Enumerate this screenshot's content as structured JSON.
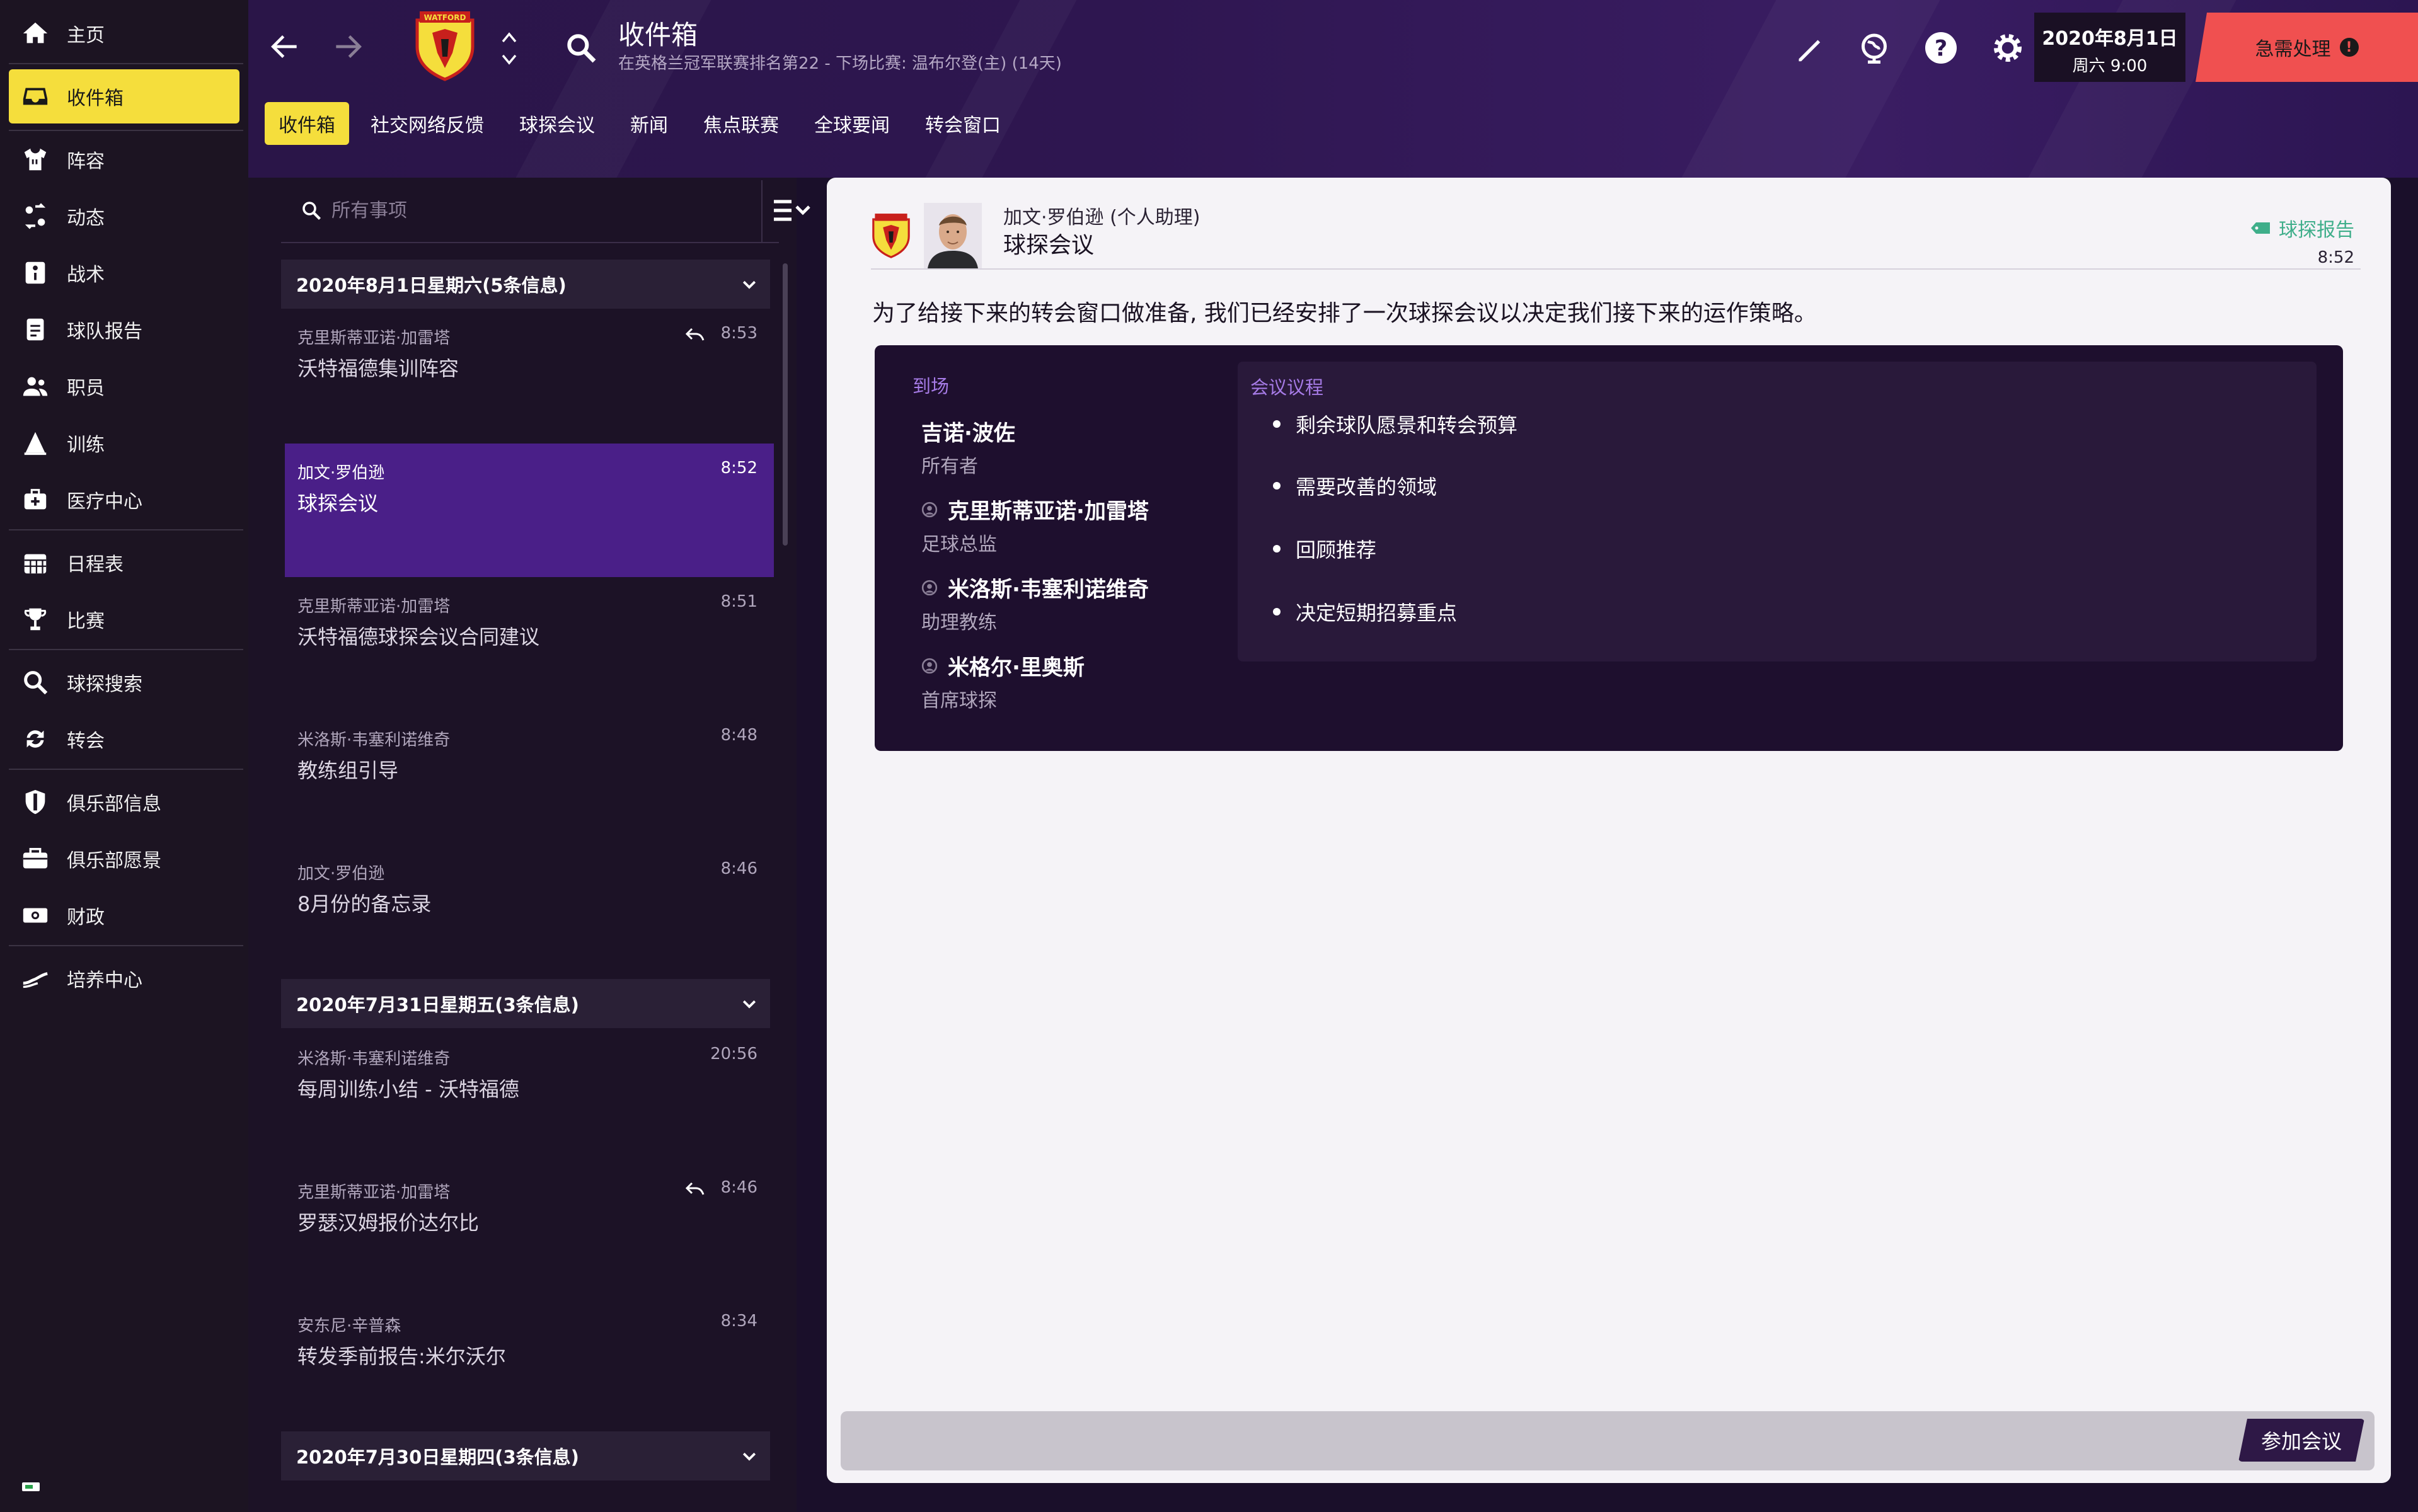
{
  "sidebar": {
    "items": [
      {
        "label": "主页",
        "icon": "home-icon"
      },
      {
        "label": "收件箱",
        "icon": "inbox-icon"
      },
      {
        "label": "阵容",
        "icon": "shirt-icon"
      },
      {
        "label": "动态",
        "icon": "dynamics-icon"
      },
      {
        "label": "战术",
        "icon": "tactics-icon"
      },
      {
        "label": "球队报告",
        "icon": "report-icon"
      },
      {
        "label": "职员",
        "icon": "staff-icon"
      },
      {
        "label": "训练",
        "icon": "training-icon"
      },
      {
        "label": "医疗中心",
        "icon": "medical-icon"
      },
      {
        "label": "日程表",
        "icon": "calendar-icon"
      },
      {
        "label": "比赛",
        "icon": "trophy-icon"
      },
      {
        "label": "球探搜索",
        "icon": "search-icon"
      },
      {
        "label": "转会",
        "icon": "transfer-icon"
      },
      {
        "label": "俱乐部信息",
        "icon": "shield-icon"
      },
      {
        "label": "俱乐部愿景",
        "icon": "briefcase-icon"
      },
      {
        "label": "财政",
        "icon": "money-icon"
      },
      {
        "label": "培养中心",
        "icon": "development-icon"
      }
    ]
  },
  "header": {
    "title": "收件箱",
    "subtitle": "在英格兰冠军联赛排名第22 - 下场比赛: 温布尔登(主) (14天)",
    "club_badge_text": "WATFORD",
    "tabs": [
      "收件箱",
      "社交网络反馈",
      "球探会议",
      "新闻",
      "焦点联赛",
      "全球要闻",
      "转会窗口"
    ],
    "date": "2020年8月1日",
    "day_time": "周六 9:00",
    "urgent_label": "急需处理",
    "urgent_mark": "!"
  },
  "inbox": {
    "search_placeholder": "所有事项",
    "groups": [
      {
        "title": "2020年8月1日星期六(5条信息)",
        "messages": [
          {
            "sender": "克里斯蒂亚诺·加雷塔",
            "subject": "沃特福德集训阵容",
            "time": "8:53"
          },
          {
            "sender": "加文·罗伯逊",
            "subject": "球探会议",
            "time": "8:52"
          },
          {
            "sender": "克里斯蒂亚诺·加雷塔",
            "subject": "沃特福德球探会议合同建议",
            "time": "8:51"
          },
          {
            "sender": "米洛斯·韦塞利诺维奇",
            "subject": "教练组引导",
            "time": "8:48"
          },
          {
            "sender": "加文·罗伯逊",
            "subject": "8月份的备忘录",
            "time": "8:46"
          }
        ]
      },
      {
        "title": "2020年7月31日星期五(3条信息)",
        "messages": [
          {
            "sender": "米洛斯·韦塞利诺维奇",
            "subject": "每周训练小结 - 沃特福德",
            "time": "20:56"
          },
          {
            "sender": "克里斯蒂亚诺·加雷塔",
            "subject": "罗瑟汉姆报价达尔比",
            "time": "8:46"
          },
          {
            "sender": "安东尼·辛普森",
            "subject": "转发季前报告:米尔沃尔",
            "time": "8:34"
          }
        ]
      },
      {
        "title": "2020年7月30日星期四(3条信息)",
        "messages": []
      }
    ]
  },
  "message": {
    "from": "加文·罗伯逊 (个人助理)",
    "subject": "球探会议",
    "tag": "球探报告",
    "time": "8:52",
    "body": "为了给接下来的转会窗口做准备, 我们已经安排了一次球探会议以决定我们接下来的运作策略。",
    "attendees_title": "到场",
    "attendees": [
      {
        "name": "吉诺·波佐",
        "role": "所有者"
      },
      {
        "name": "克里斯蒂亚诺·加雷塔",
        "role": "足球总监"
      },
      {
        "name": "米洛斯·韦塞利诺维奇",
        "role": "助理教练"
      },
      {
        "name": "米格尔·里奥斯",
        "role": "首席球探"
      }
    ],
    "agenda_title": "会议议程",
    "agenda": [
      "剩余球队愿景和转会预算",
      "需要改善的领域",
      "回顾推荐",
      "决定短期招募重点"
    ],
    "action_button": "参加会议"
  },
  "colors": {
    "accent_yellow": "#f5de3c",
    "urgent_red": "#f05050",
    "selected_purple": "#4a1f88",
    "tag_green": "#3fae8a"
  }
}
